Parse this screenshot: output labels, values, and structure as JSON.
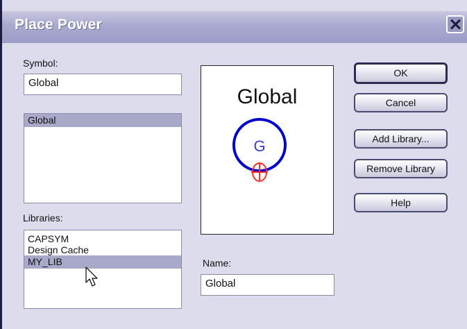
{
  "window": {
    "title": "Place Power"
  },
  "symbol": {
    "label": "Symbol:",
    "value": "Global"
  },
  "symbol_list": {
    "items": [
      "Global"
    ],
    "selected": 0
  },
  "libraries": {
    "label": "Libraries:",
    "items": [
      "CAPSYM",
      "Design Cache",
      "MY_LIB"
    ],
    "selected": 2
  },
  "preview": {
    "name_text": "Global",
    "symbol_letter": "G"
  },
  "name": {
    "label": "Name:",
    "value": "Global"
  },
  "buttons": {
    "ok": "OK",
    "cancel": "Cancel",
    "add_library": "Add Library...",
    "remove_library": "Remove Library",
    "help": "Help"
  },
  "icons": {
    "close": "close-icon",
    "cursor": "mouse-pointer-icon"
  },
  "colors": {
    "symbol_circle": "#0000cc",
    "pin_marker": "#ff2a2a",
    "selection": "#a8a8c8"
  }
}
